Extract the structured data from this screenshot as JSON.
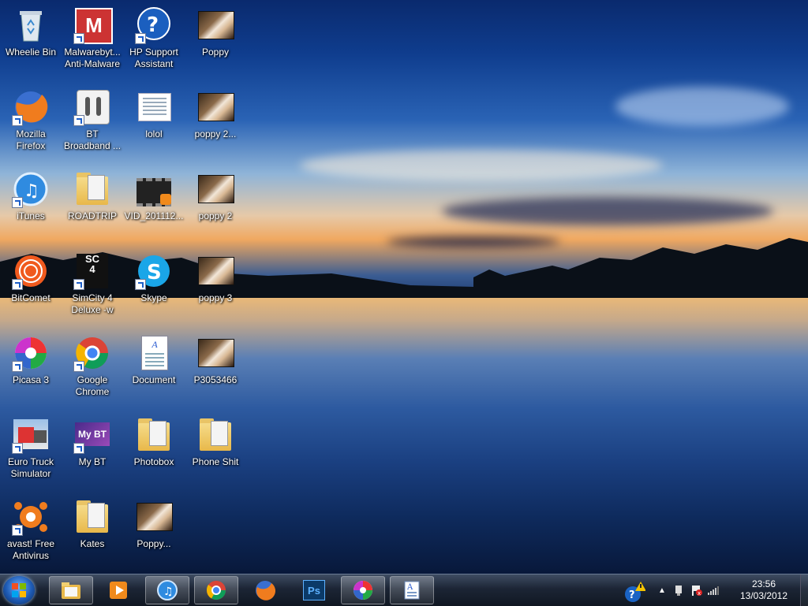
{
  "desktop": {
    "icons": [
      {
        "label": "Wheelie Bin",
        "icon": "recycle-bin-icon"
      },
      {
        "label": "Malwarebyt...\nAnti-Malware",
        "icon": "malwarebytes-icon"
      },
      {
        "label": "HP Support\nAssistant",
        "icon": "hp-support-icon"
      },
      {
        "label": "Poppy",
        "icon": "image-thumbnail-icon"
      },
      {
        "label": "Mozilla\nFirefox",
        "icon": "firefox-icon"
      },
      {
        "label": "BT\nBroadband ...",
        "icon": "bt-broadband-icon"
      },
      {
        "label": "lolol",
        "icon": "text-document-icon"
      },
      {
        "label": "poppy 2...",
        "icon": "image-thumbnail-icon"
      },
      {
        "label": "iTunes",
        "icon": "itunes-icon"
      },
      {
        "label": "ROADTRIP",
        "icon": "folder-icon"
      },
      {
        "label": "VID_201112...",
        "icon": "video-file-icon"
      },
      {
        "label": "poppy 2",
        "icon": "image-thumbnail-icon"
      },
      {
        "label": "BitComet",
        "icon": "bitcomet-icon"
      },
      {
        "label": "SimCity 4\nDeluxe -w",
        "icon": "simcity4-icon"
      },
      {
        "label": "Skype",
        "icon": "skype-icon"
      },
      {
        "label": "poppy 3",
        "icon": "image-thumbnail-icon"
      },
      {
        "label": "Picasa 3",
        "icon": "picasa-icon"
      },
      {
        "label": "Google\nChrome",
        "icon": "chrome-icon"
      },
      {
        "label": "Document",
        "icon": "word-document-icon"
      },
      {
        "label": "P3053466",
        "icon": "image-thumbnail-icon"
      },
      {
        "label": "Euro Truck\nSimulator",
        "icon": "euro-truck-icon"
      },
      {
        "label": "My BT",
        "icon": "my-bt-icon"
      },
      {
        "label": "Photobox",
        "icon": "folder-icon"
      },
      {
        "label": "Phone Shit",
        "icon": "folder-icon"
      },
      {
        "label": "avast! Free\nAntivirus",
        "icon": "avast-icon"
      },
      {
        "label": "Kates",
        "icon": "folder-icon"
      },
      {
        "label": "Poppy...",
        "icon": "image-thumbnail-icon"
      }
    ]
  },
  "taskbar": {
    "items": [
      {
        "name": "windows-explorer",
        "icon": "folder-library-icon"
      },
      {
        "name": "media-player",
        "icon": "media-player-icon"
      },
      {
        "name": "itunes",
        "icon": "itunes-icon"
      },
      {
        "name": "chrome",
        "icon": "chrome-icon"
      },
      {
        "name": "firefox",
        "icon": "firefox-icon"
      },
      {
        "name": "photoshop",
        "icon": "photoshop-icon",
        "text": "Ps"
      },
      {
        "name": "picasa",
        "icon": "picasa-icon"
      },
      {
        "name": "wordpad",
        "icon": "wordpad-icon"
      }
    ],
    "clock": {
      "time": "23:56",
      "date": "13/03/2012"
    }
  }
}
